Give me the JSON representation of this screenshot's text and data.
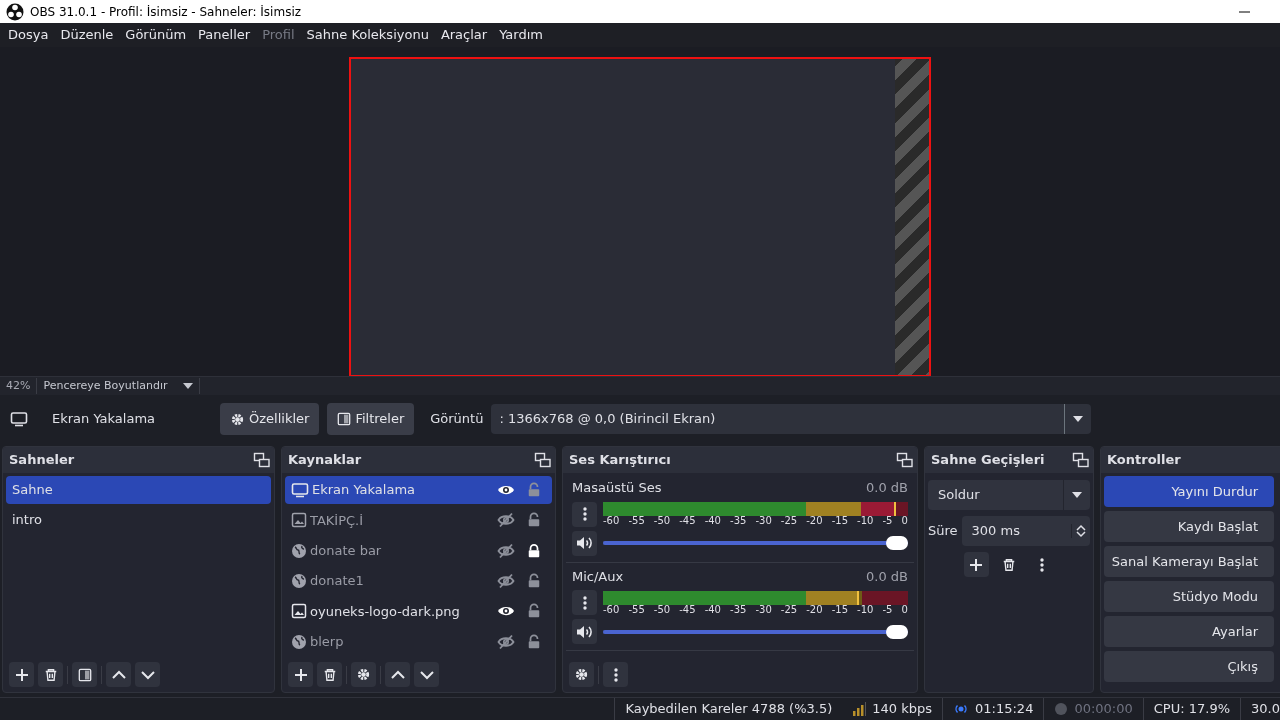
{
  "window": {
    "title": "OBS 31.0.1 - Profil: İsimsiz - Sahneler: İsimsiz"
  },
  "menu": [
    {
      "label": "Dosya",
      "disabled": false
    },
    {
      "label": "Düzenle",
      "disabled": false
    },
    {
      "label": "Görünüm",
      "disabled": false
    },
    {
      "label": "Paneller",
      "disabled": false
    },
    {
      "label": "Profil",
      "disabled": true
    },
    {
      "label": "Sahne Koleksiyonu",
      "disabled": false
    },
    {
      "label": "Araçlar",
      "disabled": false
    },
    {
      "label": "Yardım",
      "disabled": false
    }
  ],
  "preview": {
    "zoom": "42%",
    "scale_mode": "Pencereye Boyutlandır"
  },
  "source_bar": {
    "source": "Ekran Yakalama",
    "properties_button": "Özellikler",
    "filters_button": "Filtreler",
    "display_label": "Görüntü",
    "display_value": ": 1366x768 @ 0,0 (Birincil Ekran)"
  },
  "scenes": {
    "title": "Sahneler",
    "items": [
      {
        "name": "Sahne",
        "selected": true
      },
      {
        "name": "intro",
        "selected": false
      }
    ]
  },
  "sources": {
    "title": "Kaynaklar",
    "items": [
      {
        "name": "Ekran Yakalama",
        "kind": "display",
        "visible": true,
        "locked": false,
        "selected": true
      },
      {
        "name": "TAKİPÇ.İ",
        "kind": "image",
        "visible": false,
        "locked": false,
        "selected": false
      },
      {
        "name": "donate bar",
        "kind": "browser",
        "visible": false,
        "locked": true,
        "selected": false
      },
      {
        "name": "donate1",
        "kind": "browser",
        "visible": false,
        "locked": false,
        "selected": false
      },
      {
        "name": "oyuneks-logo-dark.png",
        "kind": "image",
        "visible": true,
        "locked": false,
        "selected": false
      },
      {
        "name": "blerp",
        "kind": "browser",
        "visible": false,
        "locked": false,
        "selected": false
      }
    ]
  },
  "mixer": {
    "title": "Ses Karıştırıcı",
    "channels": [
      {
        "name": "Masaüstü Ses",
        "reading": "0.0 dB",
        "level": 0.96,
        "volume": {
          "level": 1
        },
        "scale": [
          "-60",
          "-55",
          "-50",
          "-45",
          "-40",
          "-35",
          "-30",
          "-25",
          "-20",
          "-15",
          "-10",
          "-5",
          "0"
        ]
      },
      {
        "name": "Mic/Aux",
        "reading": "0.0 dB",
        "level": 0.84,
        "volume": {
          "level": 1
        },
        "scale": [
          "-60",
          "-55",
          "-50",
          "-45",
          "-40",
          "-35",
          "-30",
          "-25",
          "-20",
          "-15",
          "-10",
          "-5",
          "0"
        ]
      }
    ]
  },
  "transitions": {
    "title": "Sahne Geçişleri",
    "transition": "Soldur",
    "duration_label": "Süre",
    "duration": "300 ms"
  },
  "controls": {
    "title": "Kontroller",
    "buttons": [
      {
        "label": "Yayını Durdur",
        "active": true
      },
      {
        "label": "Kaydı Başlat",
        "active": false
      },
      {
        "label": "Sanal Kamerayı Başlat",
        "active": false
      },
      {
        "label": "Stüdyo Modu",
        "active": false
      },
      {
        "label": "Ayarlar",
        "active": false
      },
      {
        "label": "Çıkış",
        "active": false
      }
    ]
  },
  "status_bar": {
    "dropped_frames": "Kaybedilen Kareler 4788 (%3.5)",
    "bitrate": "140 kbps",
    "stream": {
      "time": "01:15:24",
      "live": true
    },
    "recording": {
      "time": "00:00:00",
      "active": false
    },
    "cpu": "CPU: 17.9%",
    "fps": "30.0"
  }
}
